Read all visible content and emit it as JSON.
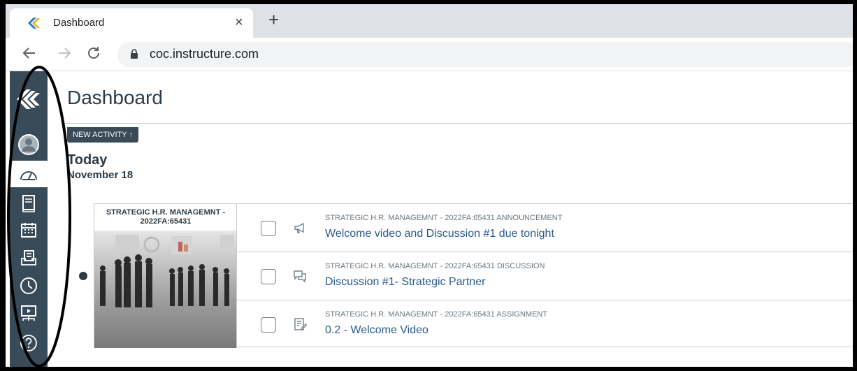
{
  "browser": {
    "tab_title": "Dashboard",
    "tab_close": "×",
    "new_tab": "+",
    "url": "coc.instructure.com"
  },
  "global_nav": {
    "items": [
      {
        "name": "logo",
        "icon": "canvas-logo-icon"
      },
      {
        "name": "account",
        "icon": "avatar-icon"
      },
      {
        "name": "dashboard",
        "icon": "dashboard-icon",
        "active": true
      },
      {
        "name": "courses",
        "icon": "courses-icon"
      },
      {
        "name": "calendar",
        "icon": "calendar-icon"
      },
      {
        "name": "inbox",
        "icon": "inbox-icon"
      },
      {
        "name": "history",
        "icon": "clock-icon"
      },
      {
        "name": "studio",
        "icon": "studio-icon"
      },
      {
        "name": "help",
        "icon": "help-icon"
      }
    ]
  },
  "page": {
    "title": "Dashboard",
    "new_activity": "NEW ACTIVITY ↑",
    "today": "Today",
    "date": "November 18"
  },
  "course": {
    "label": "STRATEGIC H.R. MANAGEMNT - 2022FA:65431"
  },
  "items": [
    {
      "context": "STRATEGIC H.R. MANAGEMNT - 2022FA:65431 ANNOUNCEMENT",
      "title": "Welcome video and Discussion #1 due tonight",
      "icon": "announcement-icon"
    },
    {
      "context": "STRATEGIC H.R. MANAGEMNT - 2022FA:65431 DISCUSSION",
      "title": "Discussion #1- Strategic Partner",
      "icon": "discussion-icon"
    },
    {
      "context": "STRATEGIC H.R. MANAGEMNT - 2022FA:65431 ASSIGNMENT",
      "title": "0.2 - Welcome Video",
      "icon": "assignment-icon"
    }
  ],
  "colors": {
    "nav_bg": "#394b58",
    "link": "#2b5b8f",
    "text": "#2d3b45"
  }
}
